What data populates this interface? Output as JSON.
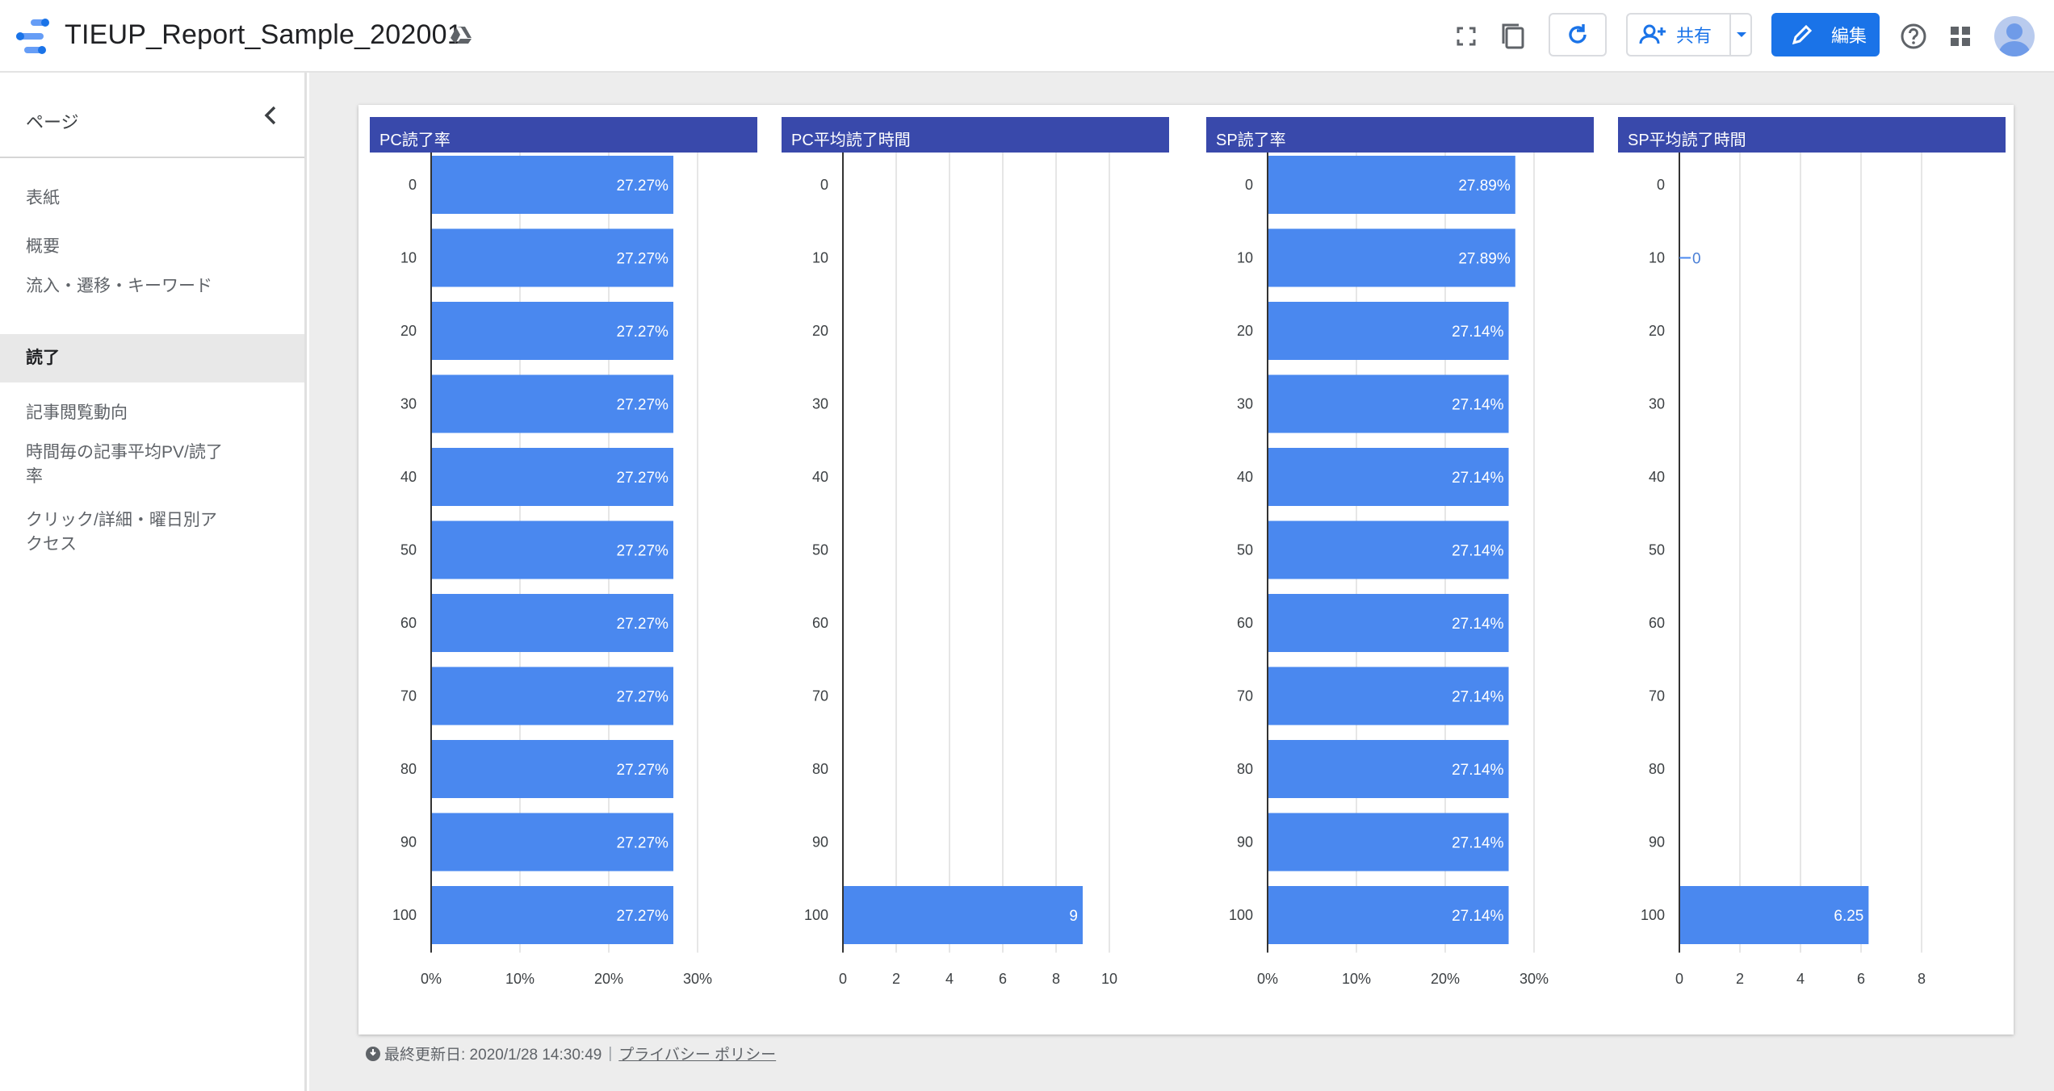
{
  "header": {
    "title": "TIEUP_Report_Sample_202001",
    "share_label": "共有",
    "edit_label": "編集",
    "colors": {
      "accent": "#1a73e8",
      "chart_header": "#3949ab",
      "bar": "#4a88ef"
    }
  },
  "sidebar": {
    "title": "ページ",
    "items": [
      {
        "label": "表紙"
      },
      {
        "label": "概要"
      },
      {
        "label": "流入・遷移・キーワード"
      },
      {
        "label": "読了"
      },
      {
        "label": "記事閲覧動向"
      },
      {
        "label": "時間毎の記事平均PV/読了率"
      },
      {
        "label": "クリック/詳細・曜日別アクセス"
      }
    ],
    "active_label": "読了"
  },
  "footer": {
    "updated": "最終更新日: 2020/1/28 14:30:49",
    "privacy": "プライバシー ポリシー"
  },
  "chart_data": [
    {
      "type": "bar",
      "orientation": "horizontal",
      "title": "PC読了率",
      "categories": [
        "0",
        "10",
        "20",
        "30",
        "40",
        "50",
        "60",
        "70",
        "80",
        "90",
        "100"
      ],
      "values": [
        27.27,
        27.27,
        27.27,
        27.27,
        27.27,
        27.27,
        27.27,
        27.27,
        27.27,
        27.27,
        27.27
      ],
      "labels": [
        "27.27%",
        "27.27%",
        "27.27%",
        "27.27%",
        "27.27%",
        "27.27%",
        "27.27%",
        "27.27%",
        "27.27%",
        "27.27%",
        "27.27%"
      ],
      "xlim": [
        0,
        30
      ],
      "xticks": [
        "0%",
        "10%",
        "20%",
        "30%"
      ],
      "grid": true
    },
    {
      "type": "bar",
      "orientation": "horizontal",
      "title": "PC平均読了時間",
      "categories": [
        "0",
        "10",
        "20",
        "30",
        "40",
        "50",
        "60",
        "70",
        "80",
        "90",
        "100"
      ],
      "values": [
        null,
        null,
        null,
        null,
        null,
        null,
        null,
        null,
        null,
        null,
        9
      ],
      "labels": [
        "",
        "",
        "",
        "",
        "",
        "",
        "",
        "",
        "",
        "",
        "9"
      ],
      "xlim": [
        0,
        10
      ],
      "xticks": [
        "0",
        "2",
        "4",
        "6",
        "8",
        "10"
      ],
      "grid": true
    },
    {
      "type": "bar",
      "orientation": "horizontal",
      "title": "SP読了率",
      "categories": [
        "0",
        "10",
        "20",
        "30",
        "40",
        "50",
        "60",
        "70",
        "80",
        "90",
        "100"
      ],
      "values": [
        27.89,
        27.89,
        27.14,
        27.14,
        27.14,
        27.14,
        27.14,
        27.14,
        27.14,
        27.14,
        27.14
      ],
      "labels": [
        "27.89%",
        "27.89%",
        "27.14%",
        "27.14%",
        "27.14%",
        "27.14%",
        "27.14%",
        "27.14%",
        "27.14%",
        "27.14%",
        "27.14%"
      ],
      "xlim": [
        0,
        30
      ],
      "xticks": [
        "0%",
        "10%",
        "20%",
        "30%"
      ],
      "grid": true
    },
    {
      "type": "bar",
      "orientation": "horizontal",
      "title": "SP平均読了時間",
      "categories": [
        "0",
        "10",
        "20",
        "30",
        "40",
        "50",
        "60",
        "70",
        "80",
        "90",
        "100"
      ],
      "values": [
        null,
        0,
        null,
        null,
        null,
        null,
        null,
        null,
        null,
        null,
        6.25
      ],
      "labels": [
        "",
        "0",
        "",
        "",
        "",
        "",
        "",
        "",
        "",
        "",
        "6.25"
      ],
      "xlim": [
        0,
        8.8
      ],
      "xticks": [
        "0",
        "2",
        "4",
        "6",
        "8"
      ],
      "grid": true
    }
  ]
}
